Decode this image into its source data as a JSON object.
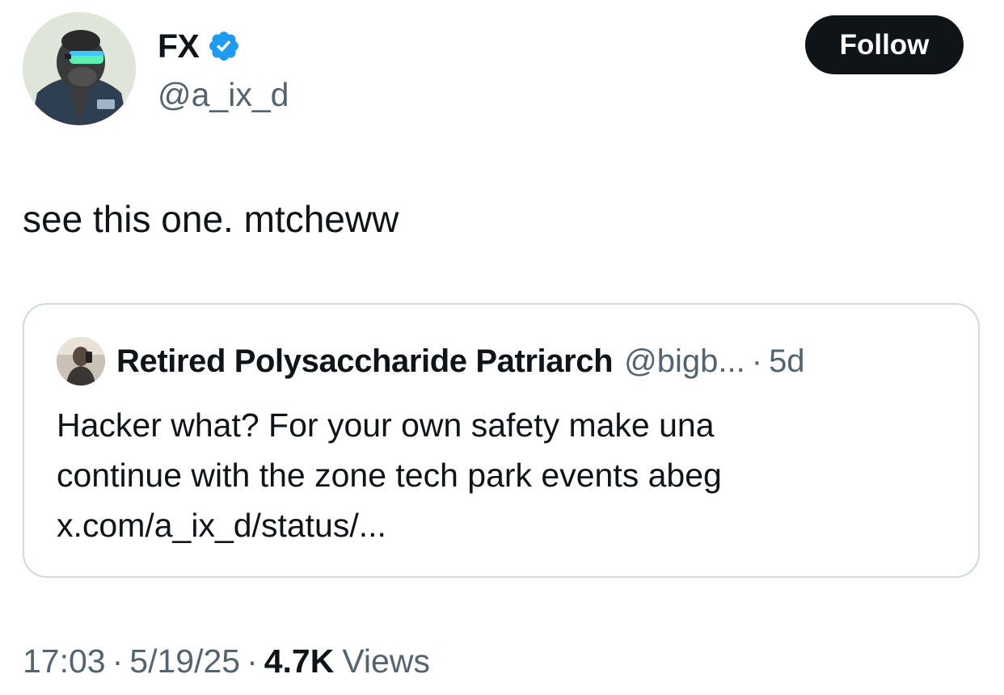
{
  "author": {
    "display_name": "FX",
    "handle": "@a_ix_d",
    "verified": true,
    "verified_color": "#1d9bf0"
  },
  "follow_button": {
    "label": "Follow"
  },
  "tweet": {
    "text": "see this one. mtcheww"
  },
  "quoted_tweet": {
    "display_name": "Retired Polysaccharide Patriarch",
    "handle": "@bigb...",
    "separator": "·",
    "age": "5d",
    "body_line_1": "Hacker what? For your own safety make una",
    "body_line_2": "continue with the zone tech park events abeg",
    "link": "x.com/a_ix_d/status/..."
  },
  "meta": {
    "time": "17:03",
    "date": "5/19/25",
    "separator": "·",
    "views_count": "4.7K",
    "views_label": "Views"
  },
  "colors": {
    "text": "#0f1419",
    "secondary": "#536471",
    "border": "#cfd9de",
    "button_bg": "#0f1419",
    "button_text": "#ffffff"
  },
  "icons": {
    "verified": "verified-badge-icon",
    "author_avatar": "gorilla-avatar",
    "quoted_avatar": "person-avatar"
  }
}
